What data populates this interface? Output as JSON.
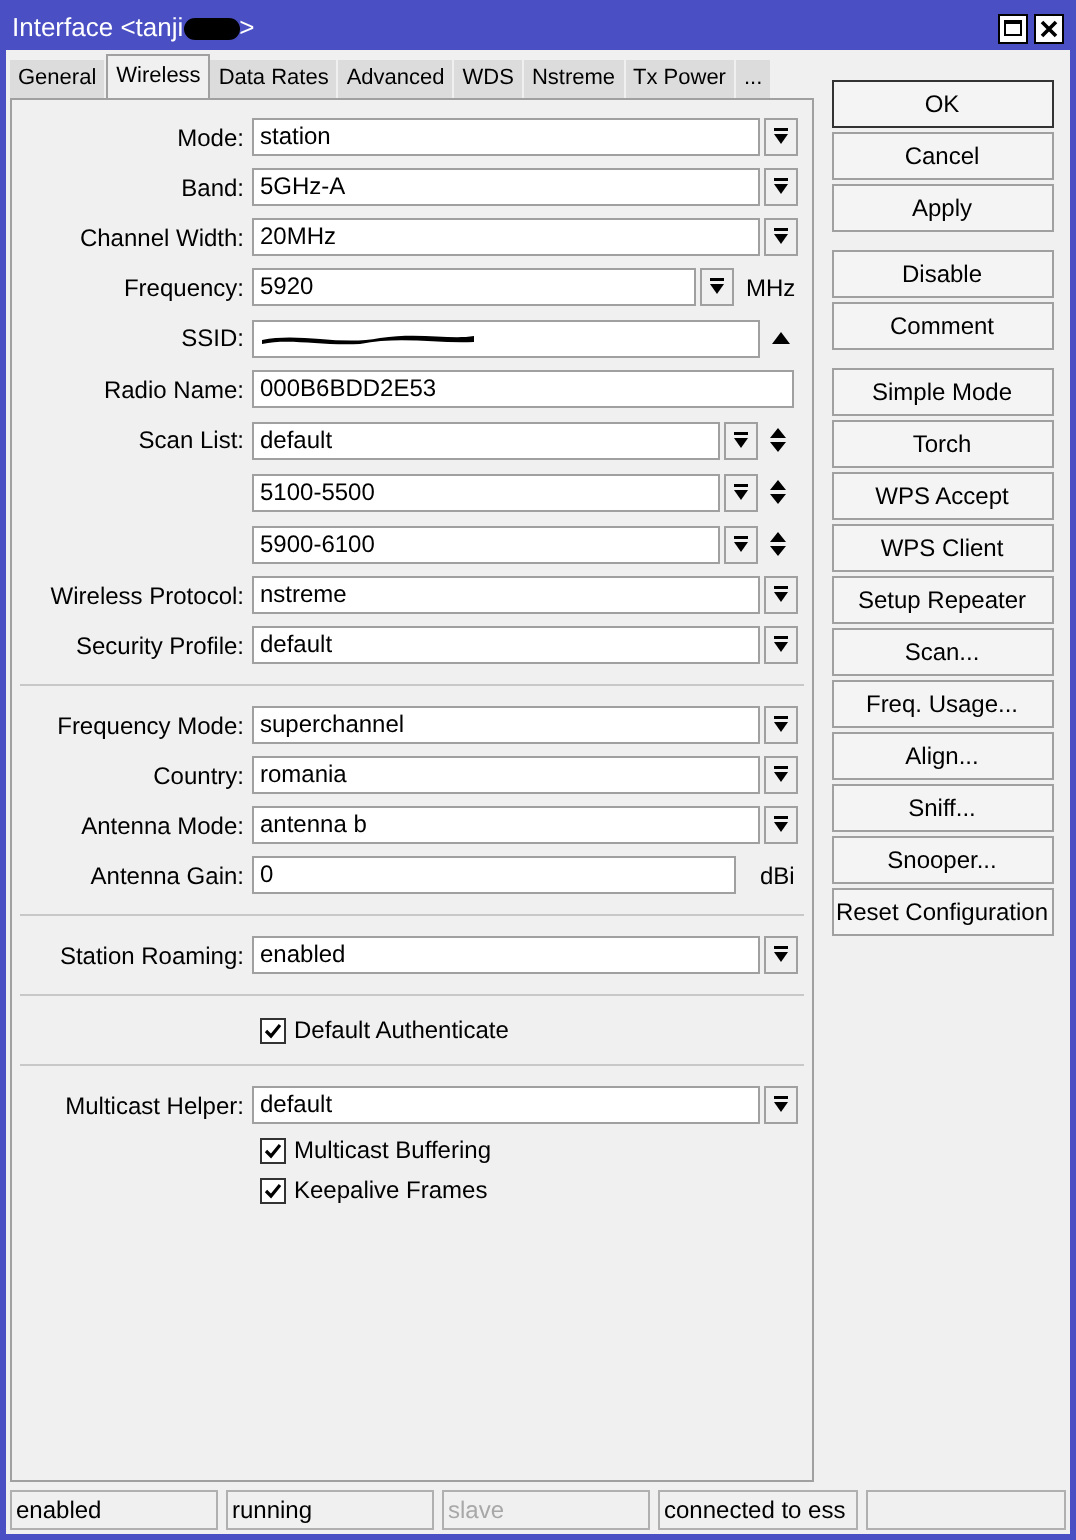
{
  "window": {
    "title_start": "Interface <tanji",
    "title_end": ">"
  },
  "tabs": [
    {
      "label": "General",
      "selected": false
    },
    {
      "label": "Wireless",
      "selected": true
    },
    {
      "label": "Data Rates",
      "selected": false
    },
    {
      "label": "Advanced",
      "selected": false
    },
    {
      "label": "WDS",
      "selected": false
    },
    {
      "label": "Nstreme",
      "selected": false
    },
    {
      "label": "Tx Power",
      "selected": false
    },
    {
      "label": "...",
      "selected": false
    }
  ],
  "fields": [
    {
      "kind": "select",
      "label": "Mode:",
      "value": "station"
    },
    {
      "kind": "select",
      "label": "Band:",
      "value": "5GHz-A"
    },
    {
      "kind": "select",
      "label": "Channel Width:",
      "value": "20MHz"
    },
    {
      "kind": "combo",
      "label": "Frequency:",
      "value": "5920",
      "unit": "MHz"
    },
    {
      "kind": "ssid",
      "label": "SSID:"
    },
    {
      "kind": "text",
      "label": "Radio Name:",
      "value": "000B6BDD2E53"
    },
    {
      "kind": "list",
      "label": "Scan List:",
      "value": "default"
    },
    {
      "kind": "list",
      "value": "5100-5500"
    },
    {
      "kind": "list",
      "value": "5900-6100"
    },
    {
      "kind": "select",
      "label": "Wireless Protocol:",
      "value": "nstreme"
    },
    {
      "kind": "select",
      "label": "Security Profile:",
      "value": "default"
    },
    {
      "kind": "divider"
    },
    {
      "kind": "select",
      "label": "Frequency Mode:",
      "value": "superchannel"
    },
    {
      "kind": "select",
      "label": "Country:",
      "value": "romania"
    },
    {
      "kind": "select",
      "label": "Antenna Mode:",
      "value": "antenna b"
    },
    {
      "kind": "text",
      "label": "Antenna Gain:",
      "value": "0",
      "unit": "dBi"
    },
    {
      "kind": "divider"
    },
    {
      "kind": "select",
      "label": "Station Roaming:",
      "value": "enabled"
    },
    {
      "kind": "divider"
    },
    {
      "kind": "checkbox",
      "label": "Default Authenticate",
      "checked": true
    },
    {
      "kind": "divider"
    },
    {
      "kind": "select",
      "label": "Multicast Helper:",
      "value": "default"
    },
    {
      "kind": "checkbox",
      "label": "Multicast Buffering",
      "checked": true
    },
    {
      "kind": "checkbox",
      "label": "Keepalive Frames",
      "checked": true
    }
  ],
  "button_groups": [
    [
      "OK",
      "Cancel",
      "Apply"
    ],
    [
      "Disable",
      "Comment"
    ],
    [
      "Simple Mode",
      "Torch",
      "WPS Accept",
      "WPS Client",
      "Setup Repeater",
      "Scan...",
      "Freq. Usage...",
      "Align...",
      "Sniff...",
      "Snooper...",
      "Reset Configuration"
    ]
  ],
  "status_bar": [
    {
      "text": "enabled",
      "disabled": false
    },
    {
      "text": "running",
      "disabled": false
    },
    {
      "text": "slave",
      "disabled": true
    },
    {
      "text": "connected to ess",
      "disabled": false
    }
  ]
}
